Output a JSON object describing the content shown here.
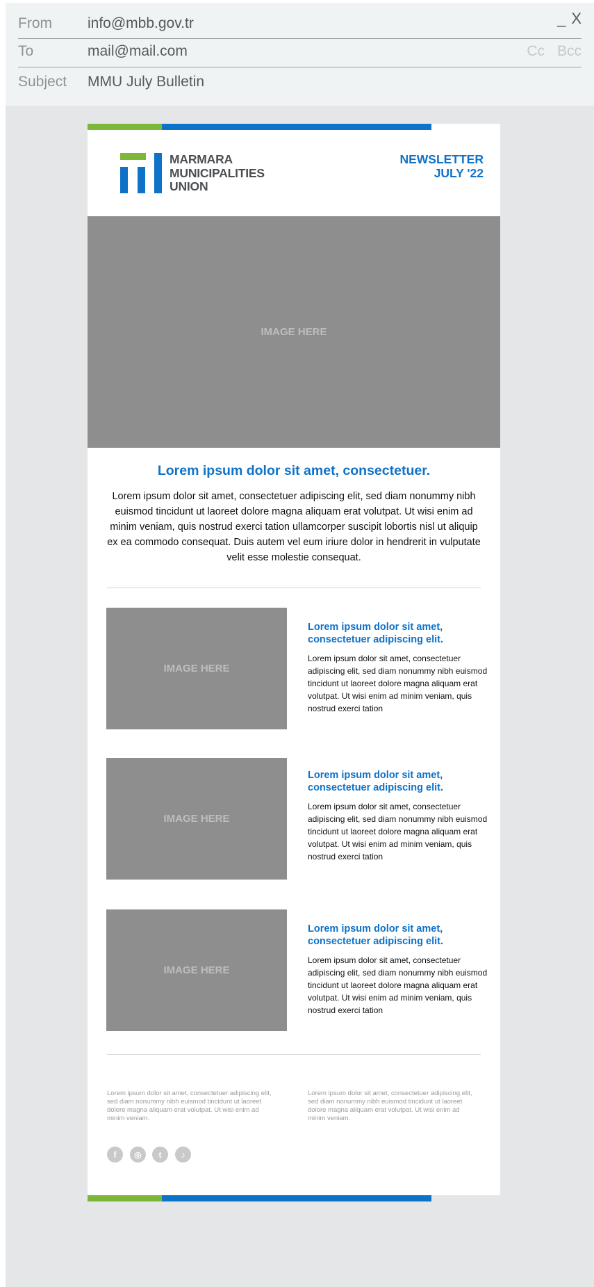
{
  "email_header": {
    "from_label": "From",
    "from_value": "info@mbb.gov.tr",
    "to_label": "To",
    "to_value": "mail@mail.com",
    "cc_label": "Cc",
    "bcc_label": "Bcc",
    "subject_label": "Subject",
    "subject_value": "MMU July Bulletin",
    "minimize_label": "_",
    "close_label": "X"
  },
  "colors": {
    "green": "#7db73a",
    "blue": "#0e72c8",
    "placeholder": "#8e8e8e"
  },
  "logo": {
    "line1": "MARMARA",
    "line2": "MUNICIPALITIES",
    "line3": "UNION"
  },
  "newsletter": {
    "line1": "NEWSLETTER",
    "line2": "JULY '22"
  },
  "hero": {
    "image_label": "IMAGE HERE"
  },
  "intro": {
    "title": "Lorem ipsum dolor sit amet, consectetuer.",
    "body": "Lorem ipsum dolor sit amet, consectetuer adipiscing elit, sed diam nonummy nibh euismod tincidunt ut laoreet dolore magna aliquam erat volutpat. Ut wisi enim ad minim veniam, quis nostrud exerci tation ullamcorper suscipit lobortis nisl ut aliquip ex ea commodo consequat. Duis autem vel eum iriure dolor in hendrerit in vulputate velit esse molestie consequat."
  },
  "articles": [
    {
      "image_label": "IMAGE HERE",
      "title": "Lorem ipsum dolor sit amet, consectetuer adipiscing elit.",
      "body": "Lorem ipsum dolor sit amet, consectetuer adipiscing elit, sed diam nonummy nibh euismod tincidunt ut laoreet dolore magna aliquam erat volutpat. Ut wisi enim ad minim veniam, quis nostrud exerci tation"
    },
    {
      "image_label": "IMAGE HERE",
      "title": "Lorem ipsum dolor sit amet, consectetuer adipiscing elit.",
      "body": "Lorem ipsum dolor sit amet, consectetuer adipiscing elit, sed diam nonummy nibh euismod tincidunt ut laoreet dolore magna aliquam erat volutpat. Ut wisi enim ad minim veniam, quis nostrud exerci tation"
    },
    {
      "image_label": "IMAGE HERE",
      "title": "Lorem ipsum dolor sit amet, consectetuer adipiscing elit.",
      "body": "Lorem ipsum dolor sit amet, consectetuer adipiscing elit, sed diam nonummy nibh euismod tincidunt ut laoreet dolore magna aliquam erat volutpat. Ut wisi enim ad minim veniam, quis nostrud exerci tation"
    }
  ],
  "footer": {
    "left_text": "Lorem ipsum dolor sit amet, consectetuer adipiscing elit, sed diam nonummy nibh euismod tincidunt ut laoreet dolore magna aliquam erat volutpat. Ut wisi enim ad minim veniam.",
    "right_text": "Lorem ipsum dolor sit amet, consectetuer adipiscing elit, sed diam nonummy nibh euismod tincidunt ut laoreet dolore magna aliquam erat volutpat. Ut wisi enim ad minim veniam."
  },
  "social": [
    {
      "icon": "facebook-icon",
      "glyph": "f"
    },
    {
      "icon": "instagram-icon",
      "glyph": "◎"
    },
    {
      "icon": "twitter-icon",
      "glyph": "t"
    },
    {
      "icon": "tiktok-icon",
      "glyph": "♪"
    }
  ]
}
